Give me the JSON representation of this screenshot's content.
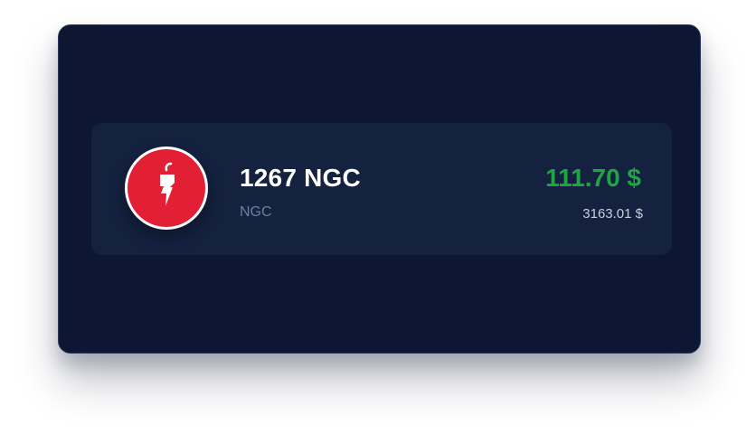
{
  "wallet_card": {
    "asset": {
      "icon": "ngc-chili-logo-icon",
      "amount": "1267 NGC",
      "ticker": "NGC",
      "value": "111.70 $",
      "price": "3163.01 $"
    }
  },
  "colors": {
    "card_background": "#0d1733",
    "row_background": "#14213f",
    "logo_red": "#e21f34",
    "value_green": "#21a443",
    "ticker_gray": "#6f7f9c"
  }
}
